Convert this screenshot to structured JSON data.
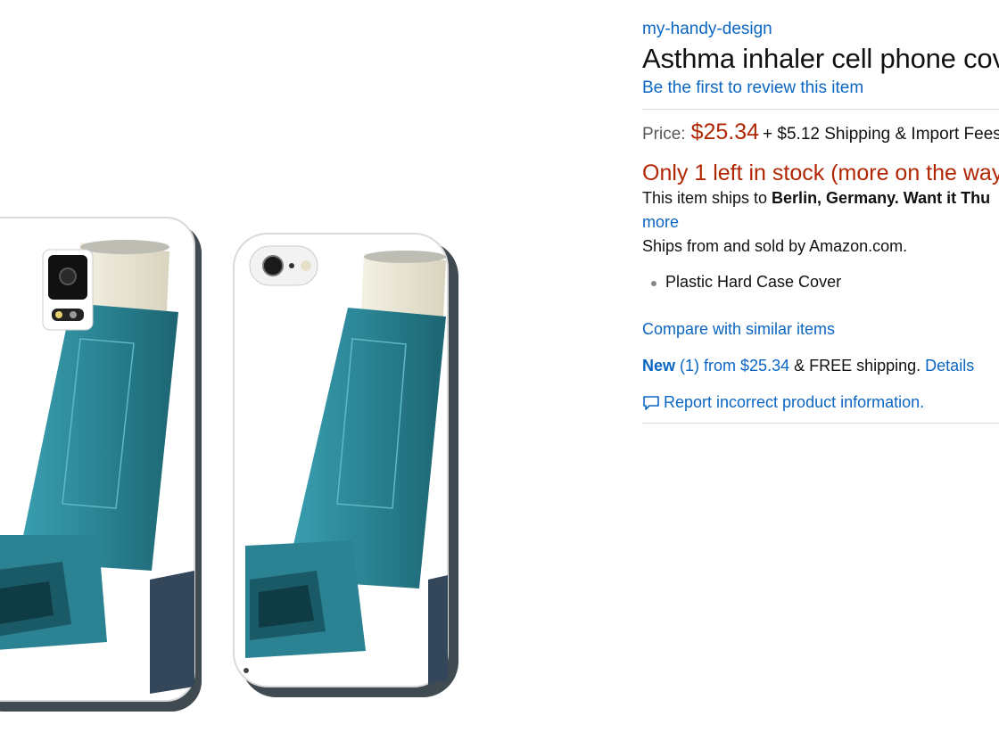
{
  "product": {
    "brand": "my-handy-design",
    "title": "Asthma inhaler cell phone cov",
    "review_link": "Be the first to review this item"
  },
  "pricing": {
    "label": "Price:",
    "price": "$25.34",
    "shipping": "+ $5.12 Shipping & Import Fees"
  },
  "availability": {
    "stock": "Only 1 left in stock (more on the way",
    "ships_to_prefix": "This item ships to ",
    "ships_to_location": "Berlin, Germany",
    "ships_to_suffix": ". ",
    "want_it": "Want it Thu",
    "more": "more",
    "sold_by": "Ships from and sold by Amazon.com."
  },
  "features": [
    "Plastic Hard Case Cover"
  ],
  "links": {
    "compare": "Compare with similar items",
    "report": "Report incorrect product information."
  },
  "offer": {
    "new_label": "New",
    "count": "(1) from $25.34",
    "free_shipping": " & FREE shipping. ",
    "details": "Details"
  },
  "colors": {
    "link": "#0b66c3",
    "price": "#b12704",
    "inhaler": "#2f8a9a"
  }
}
